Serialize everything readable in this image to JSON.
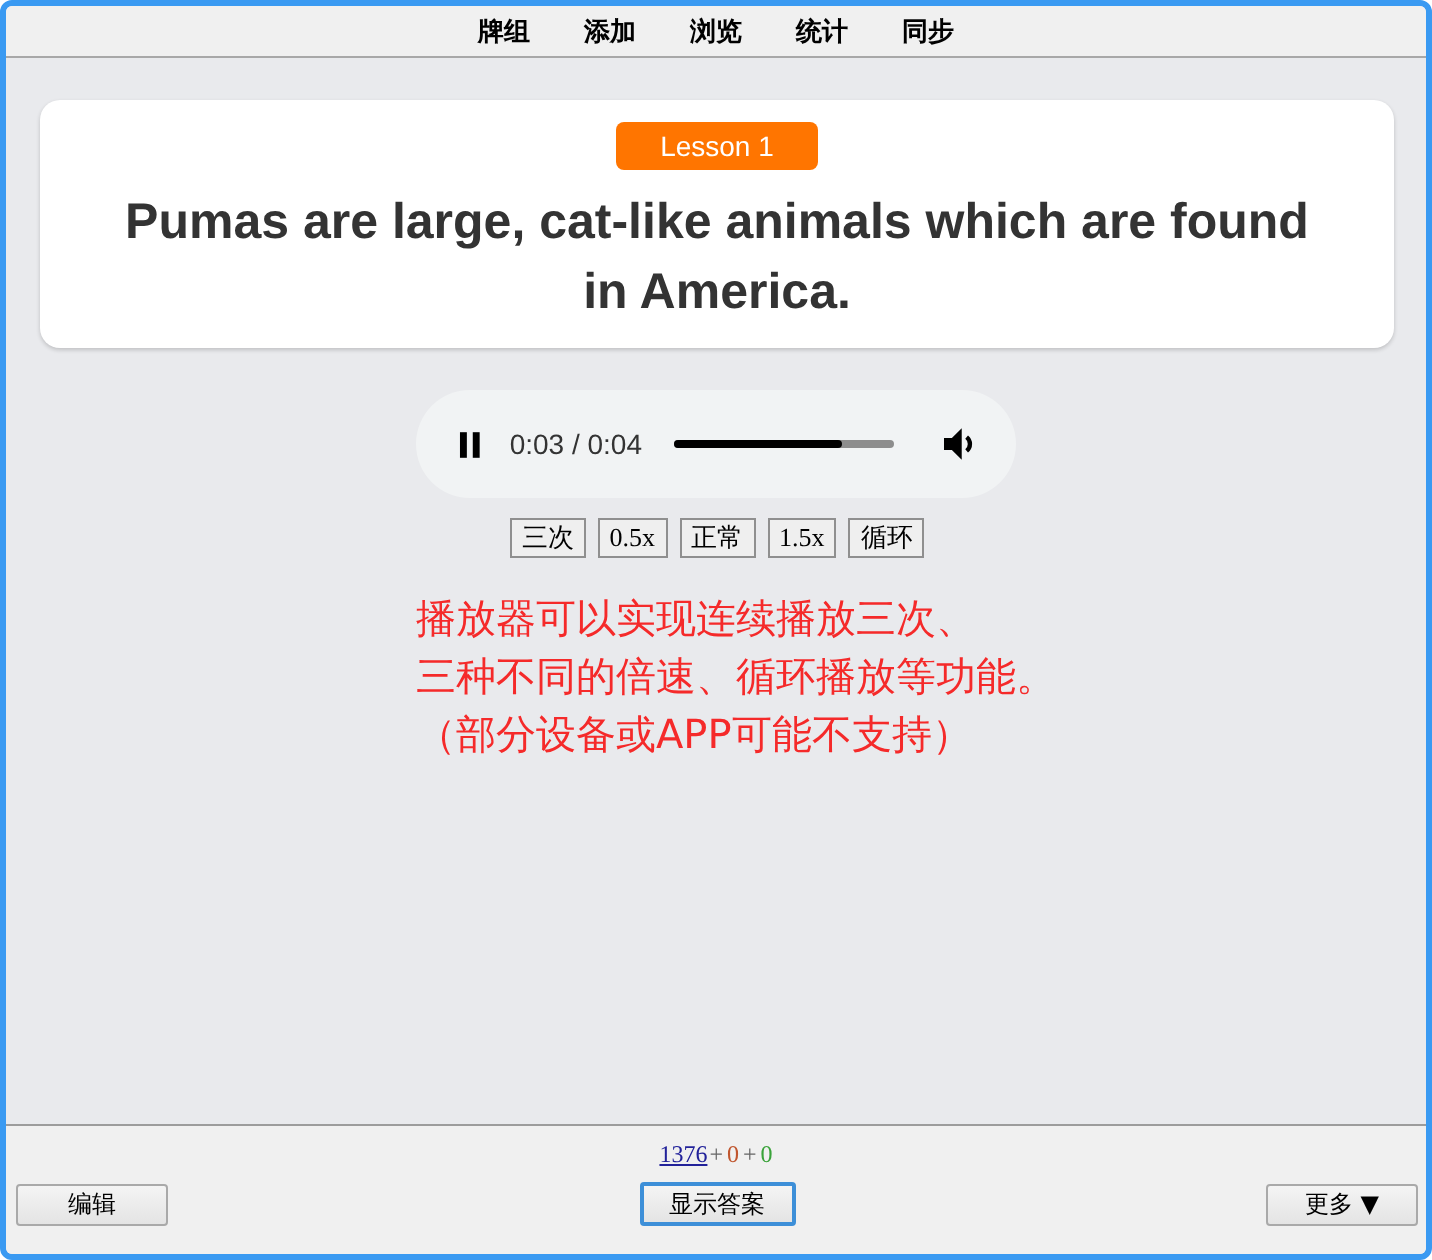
{
  "nav": [
    "牌组",
    "添加",
    "浏览",
    "统计",
    "同步"
  ],
  "card": {
    "badge": "Lesson 1",
    "sentence": "Pumas are large, cat-like animals which are found in America."
  },
  "player": {
    "playing": true,
    "time": "0:03 / 0:04",
    "level": 0.76,
    "muted": false
  },
  "speed_buttons": [
    "三次",
    "0.5x",
    "正常",
    "1.5x",
    "循环"
  ],
  "note": {
    "lines": [
      "播放器可以实现连续播放三次、",
      "三种不同的倍速、循环播放等功能。",
      "（部分设备或APP可能不支持）"
    ]
  },
  "counts": [
    {
      "kind": "link",
      "text": "1376"
    },
    {
      "kind": "separator",
      "text": "+"
    },
    {
      "kind": "count",
      "text": "0",
      "color": "#c0562e"
    },
    {
      "kind": "separator",
      "text": "+"
    },
    {
      "kind": "count",
      "text": "0",
      "color": "#3aa33a"
    }
  ],
  "bottom_buttons": [
    {
      "label": "编辑",
      "focused": false
    },
    {
      "label": "显示答案",
      "focused": true
    },
    {
      "label": "更多 ▼",
      "focused": false
    }
  ]
}
